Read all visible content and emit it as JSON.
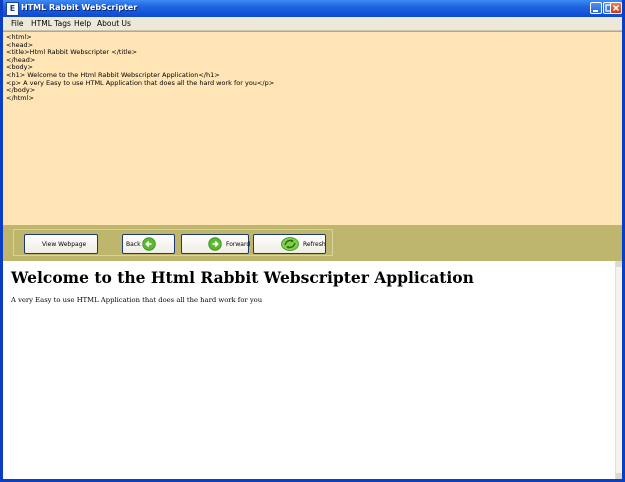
{
  "window": {
    "title": "HTML Rabbit WebScripter"
  },
  "menu": {
    "items": [
      "File",
      "HTML Tags",
      "Help",
      "About Us"
    ]
  },
  "editor": {
    "lines": [
      "<html>",
      "<head>",
      "<title>Html Rabbit Webscripter </title>",
      "</head>",
      "<body>",
      "<h1> Welcome to the Html Rabbit Webscripter Application</h1>",
      "<p> A very Easy to use HTML Application that does all the hard work for you</p>",
      "</body>",
      "</html>"
    ]
  },
  "toolbar": {
    "view_label": "View Webpage",
    "back_label": "Back",
    "forward_label": "Forward",
    "refresh_label": "Refresh"
  },
  "preview": {
    "heading": "Welcome to the Html Rabbit Webscripter Application",
    "paragraph": "A very Easy to use HTML Application that does all the hard work for you"
  },
  "icons": {
    "back": "arrow-left-icon",
    "forward": "arrow-right-icon",
    "refresh": "refresh-icon"
  },
  "colors": {
    "editor_bg": "#ffe4b5",
    "toolbar_bg": "#bfb66d",
    "titlebar": "#0b4ad0",
    "icon_green": "#5cb82e"
  }
}
